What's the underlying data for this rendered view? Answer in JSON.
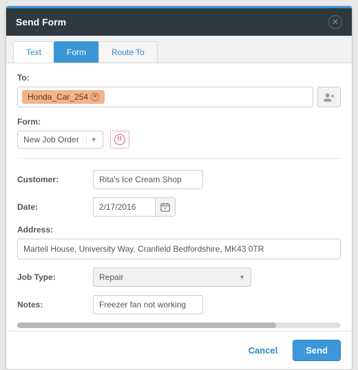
{
  "header": {
    "title": "Send Form"
  },
  "tabs": {
    "text": "Text",
    "form": "Form",
    "route": "Route To"
  },
  "to": {
    "label": "To:",
    "chip": "Honda_Car_254"
  },
  "form": {
    "label": "Form:",
    "selected": "New Job Order"
  },
  "fields": {
    "customer": {
      "label": "Customer:",
      "value": "Rita's Ice Cream Shop"
    },
    "date": {
      "label": "Date:",
      "value": "2/17/2016"
    },
    "address": {
      "label": "Address:",
      "value": "Martell House, University Way, Cranfield Bedfordshire, MK43 0TR"
    },
    "jobtype": {
      "label": "Job Type:",
      "value": "Repair"
    },
    "notes": {
      "label": "Notes:",
      "value": "Freezer fan not working"
    }
  },
  "footer": {
    "cancel": "Cancel",
    "send": "Send"
  }
}
